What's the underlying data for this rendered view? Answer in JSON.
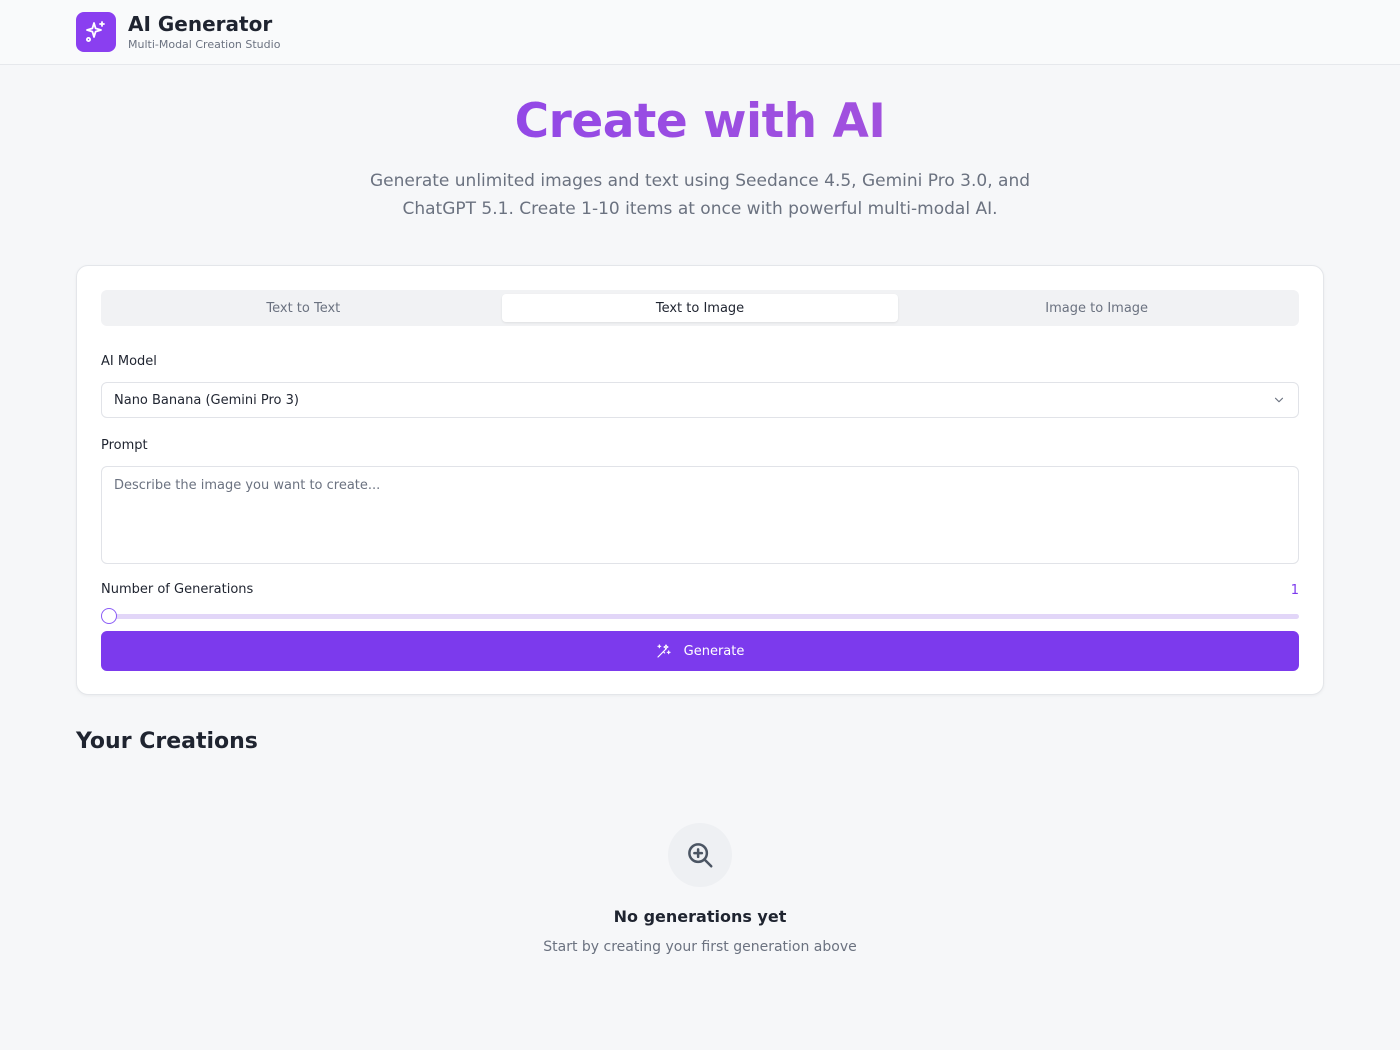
{
  "brand": {
    "title": "AI Generator",
    "subtitle": "Multi-Modal Creation Studio",
    "logo_icon": "sparkles-icon"
  },
  "hero": {
    "title": "Create with AI",
    "subtitle": "Generate unlimited images and text using Seedance 4.5, Gemini Pro 3.0, and ChatGPT 5.1. Create 1-10 items at once with powerful multi-modal AI."
  },
  "tabs": [
    {
      "label": "Text to Text",
      "active": false
    },
    {
      "label": "Text to Image",
      "active": true
    },
    {
      "label": "Image to Image",
      "active": false
    }
  ],
  "form": {
    "model_label": "AI Model",
    "model_value": "Nano Banana (Gemini Pro 3)",
    "prompt_label": "Prompt",
    "prompt_placeholder": "Describe the image you want to create...",
    "prompt_value": "",
    "generations_label": "Number of Generations",
    "generations_value": "1",
    "generations_min": 1,
    "generations_max": 10,
    "generate_label": "Generate",
    "generate_icon": "magic-wand-icon"
  },
  "creations": {
    "title": "Your Creations",
    "empty_icon": "zoom-in-icon",
    "empty_title": "No generations yet",
    "empty_subtitle": "Start by creating your first generation above"
  },
  "colors": {
    "accent": "#7c3aed",
    "logo": "#8a3ff0",
    "slider_track": "#e2d6f8"
  }
}
